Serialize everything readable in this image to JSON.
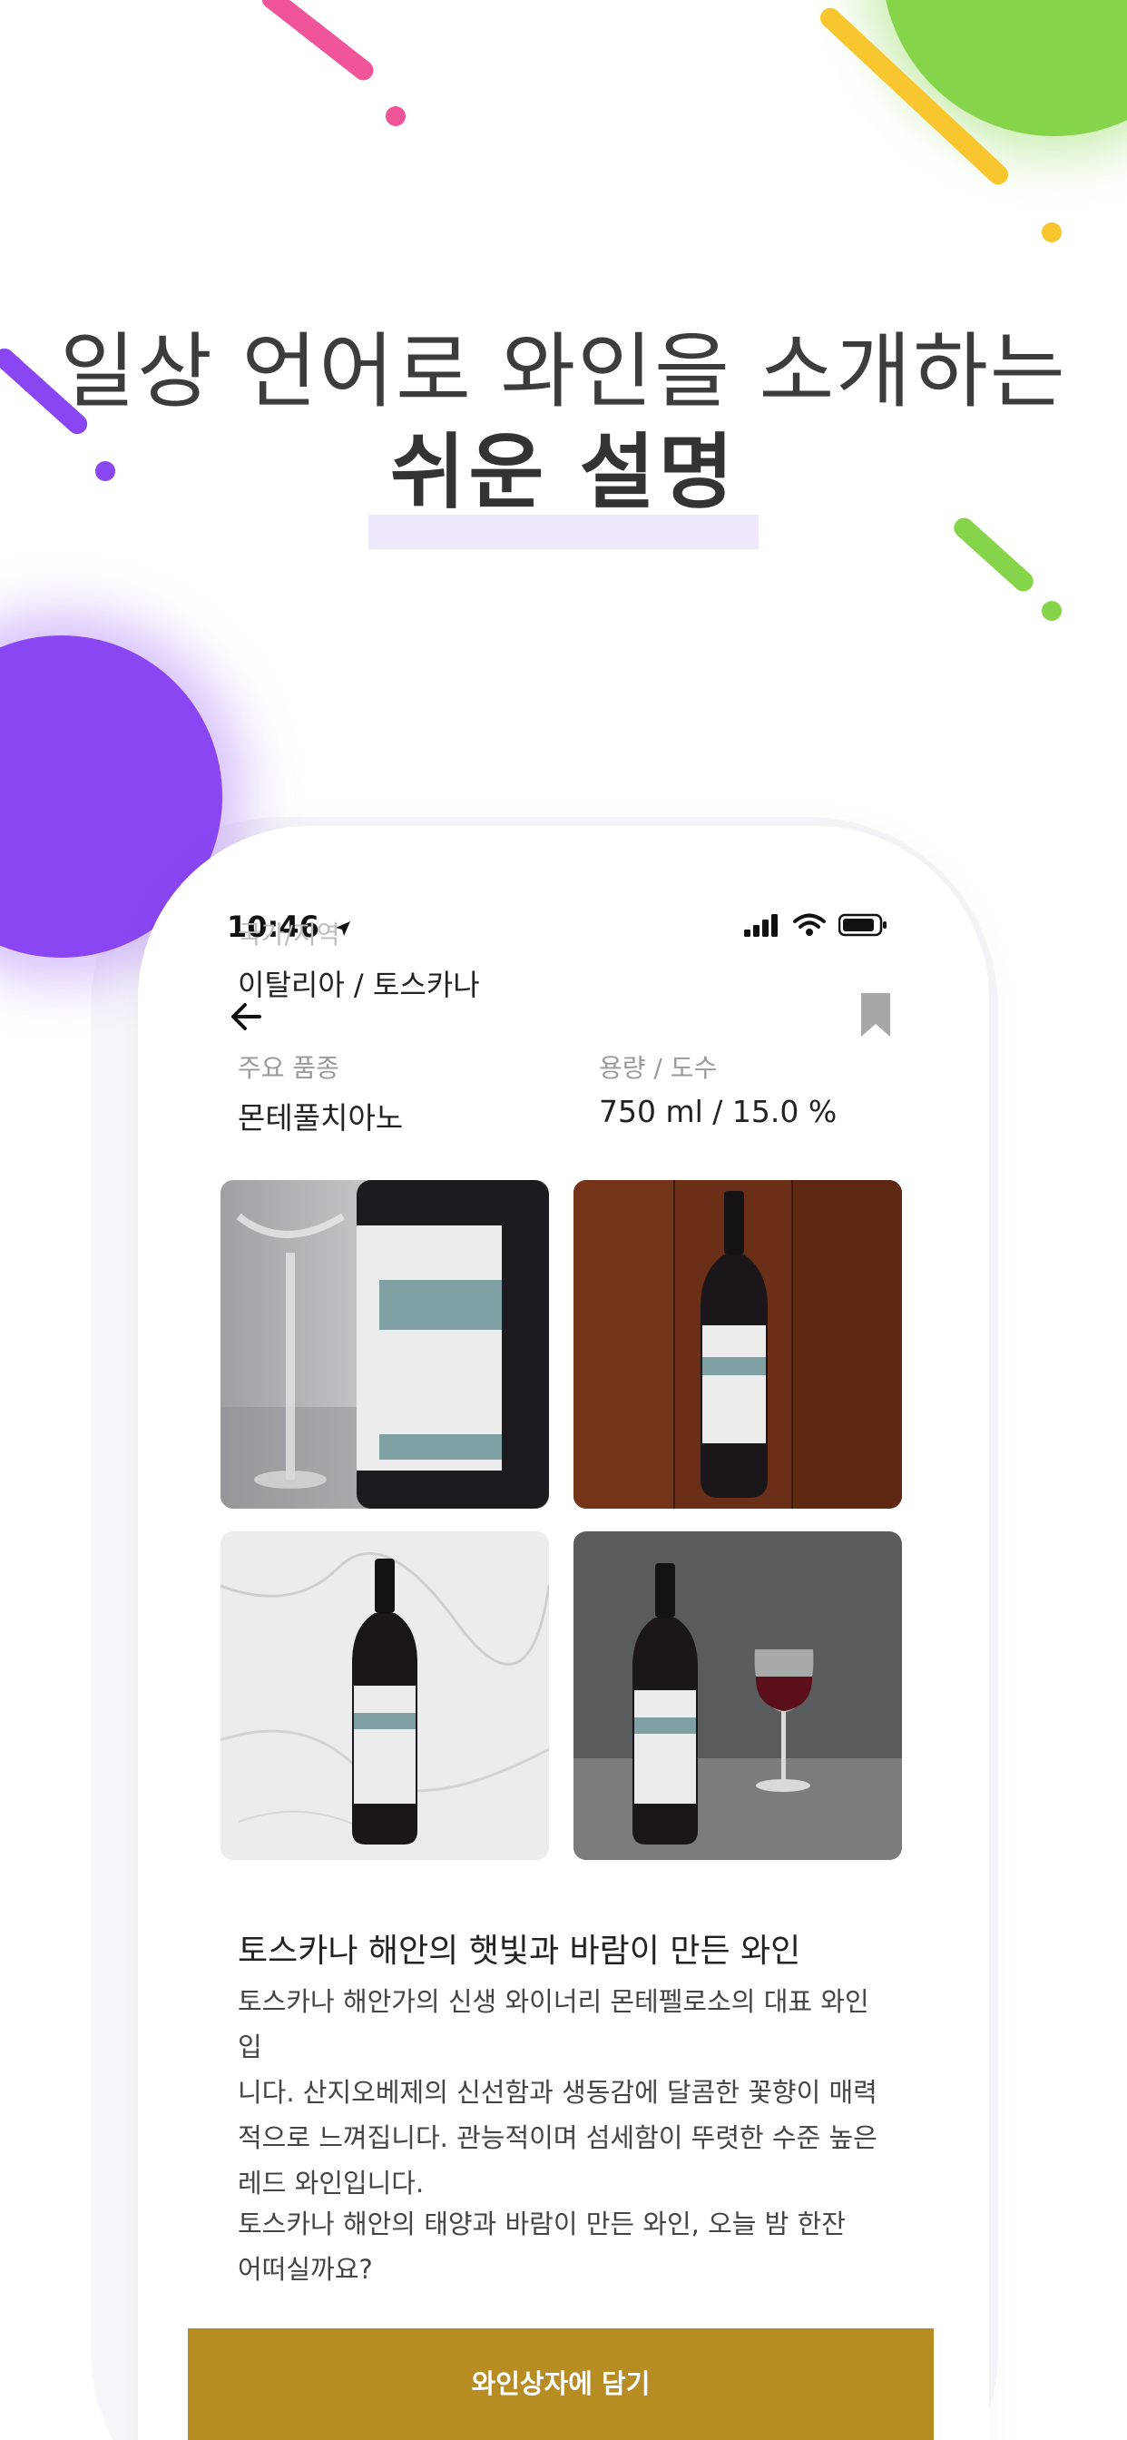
{
  "hero": {
    "line1": "일상 언어로 와인을 소개하는",
    "line2": "쉬운 설명"
  },
  "status_bar": {
    "time": "10:46"
  },
  "wine": {
    "origin_label": "국가/지역",
    "origin_value": "이탈리아 / 토스카나",
    "grape_label": "주요 품종",
    "grape_value": "몬테풀치아노",
    "volume_label": "용량 / 도수",
    "volume_value": "750 ml / 15.0 %"
  },
  "photos": [
    {
      "name": "bottle-closeup-photo"
    },
    {
      "name": "bottle-on-wood-photo"
    },
    {
      "name": "bottle-on-marble-photo"
    },
    {
      "name": "bottle-with-glass-photo"
    }
  ],
  "description": {
    "title": "토스카나 해안의 햇빛과 바람이 만든 와인",
    "body_lines": [
      "토스카나 해안가의 신생 와이너리 몬테펠로소의 대표 와인입",
      "니다. 산지오베제의 신선함과 생동감에 달콤한 꽃향이 매력",
      "적으로 느껴집니다. 관능적이며 섬세함이 뚜렷한 수준 높은",
      "레드 와인입니다."
    ],
    "extra_lines": [
      "토스카나 해안의 태양과 바람이 만든 와인, 오늘 밤 한잔",
      "어떠실까요?"
    ]
  },
  "cart_button": {
    "label": "와인상자에 담기"
  },
  "colors": {
    "accent_gold": "#b78c22",
    "purple": "#8a46f3",
    "green": "#86d44a",
    "pink": "#f0559a",
    "yellow": "#f8c62e"
  }
}
